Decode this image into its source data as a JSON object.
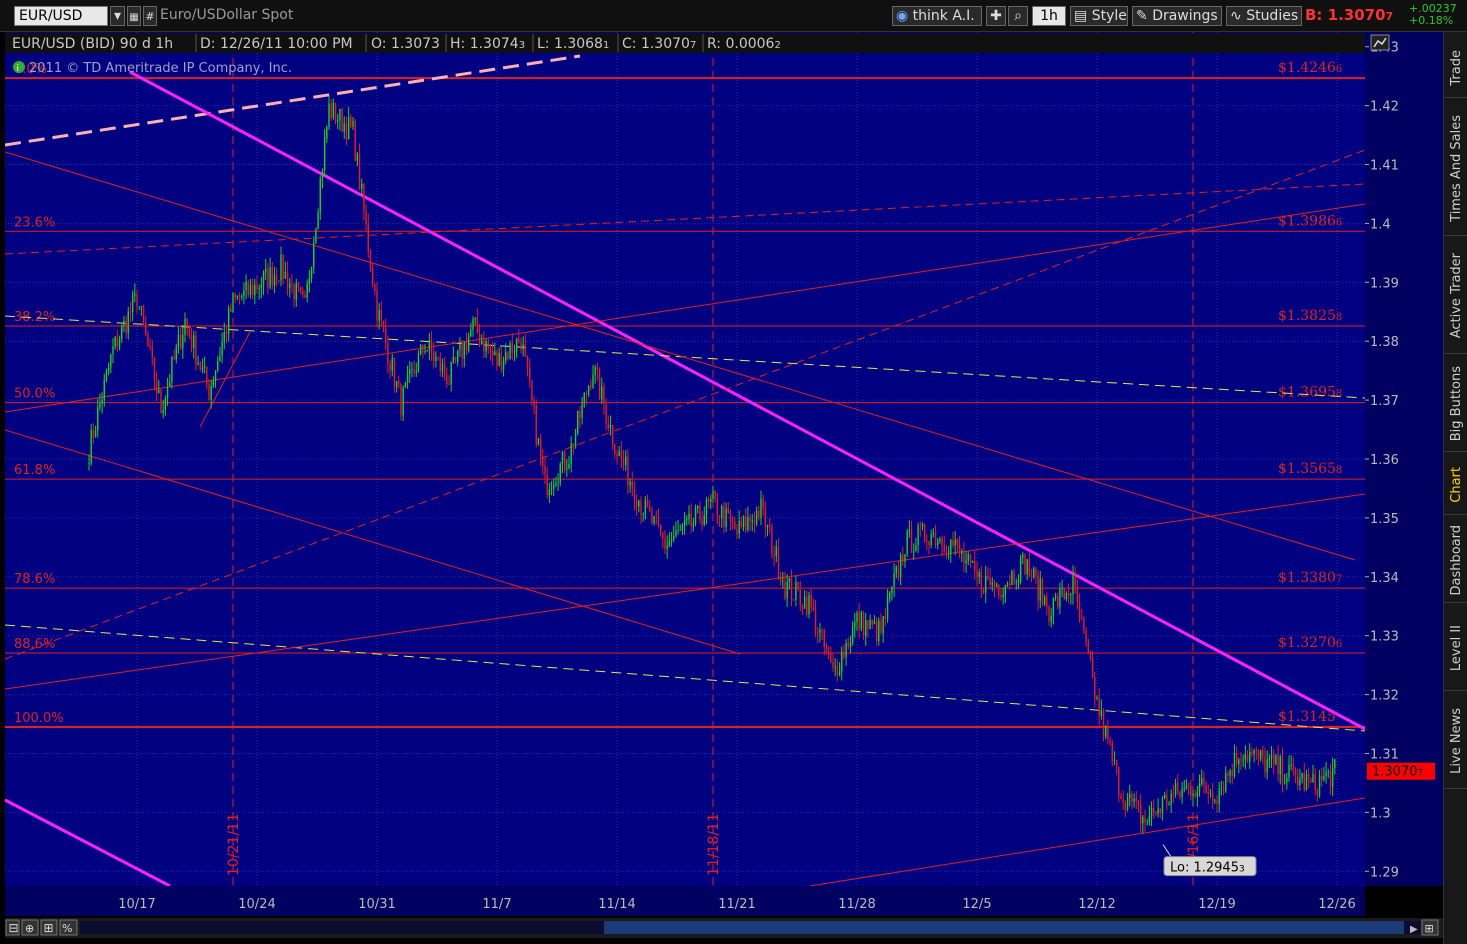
{
  "toolbar": {
    "symbol": "EUR/USD",
    "description": "Euro/USDollar Spot",
    "think_label": "think A.I.",
    "period": "1h",
    "style": "Style",
    "drawings": "Drawings",
    "studies": "Studies",
    "bid": "B: 1.3070",
    "bid_suffix": "7",
    "change_abs": "+.00237",
    "change_pct": "+0.18%"
  },
  "header": {
    "title": "EUR/USD (BID) 90 d 1h",
    "date": "D: 12/26/11 10:00 PM",
    "open": "O: 1.3073",
    "high": "H: 1.3074",
    "high_sub": "3",
    "low": "L: 1.3068",
    "low_sub": "1",
    "close": "C: 1.3070",
    "close_sub": "7",
    "range": "R: 0.0006",
    "range_sub": "2",
    "copyright": "2011 © TD Ameritrade IP Company, Inc."
  },
  "colors": {
    "background": "#000080",
    "grid": "#2a2ab0",
    "fib_line": "#e02020",
    "trend_magenta": "#ff20ff",
    "dashed_yellow": "#e6e64a",
    "dashed_pink": "#ffb0b0",
    "up_candle": "#22d022",
    "down_candle": "#e02020",
    "price_tag": "#ff0000"
  },
  "side_tabs": [
    "Trade",
    "Times And Sales",
    "Active Trader",
    "Big Buttons",
    "Chart",
    "Dashboard",
    "Level II",
    "Live News"
  ],
  "side_active": "Chart",
  "chart_data": {
    "type": "candlestick",
    "symbol": "EUR/USD",
    "x_ticks": [
      "10/17",
      "10/24",
      "10/31",
      "11/7",
      "11/14",
      "11/21",
      "11/28",
      "12/5",
      "12/12",
      "12/19",
      "12/26"
    ],
    "y_ticks": [
      1.29,
      1.3,
      1.31,
      1.32,
      1.33,
      1.34,
      1.35,
      1.36,
      1.37,
      1.38,
      1.39,
      1.4,
      1.41,
      1.42,
      1.43
    ],
    "ylim": [
      1.2875,
      1.4325
    ],
    "fib_levels": [
      {
        "pct": "0.0%",
        "price": "$1.4246",
        "sub": "6",
        "value": 1.42466
      },
      {
        "pct": "23.6%",
        "price": "$1.3986",
        "sub": "6",
        "value": 1.39866
      },
      {
        "pct": "38.2%",
        "price": "$1.3825",
        "sub": "8",
        "value": 1.38258
      },
      {
        "pct": "50.0%",
        "price": "$1.3695",
        "sub": "8",
        "value": 1.36958
      },
      {
        "pct": "61.8%",
        "price": "$1.3565",
        "sub": "8",
        "value": 1.35658
      },
      {
        "pct": "78.6%",
        "price": "$1.3380",
        "sub": "7",
        "value": 1.33807
      },
      {
        "pct": "88.6%",
        "price": "$1.3270",
        "sub": "6",
        "value": 1.32706
      },
      {
        "pct": "100.0%",
        "price": "$1.3145",
        "sub": "",
        "value": 1.3145
      }
    ],
    "vertical_markers": [
      {
        "label": "10/21/11",
        "date": "2011-10-21"
      },
      {
        "label": "11/18/11",
        "date": "2011-11-18"
      },
      {
        "label": "12/16/11",
        "date": "2011-12-16"
      }
    ],
    "last_price": "1.3070",
    "last_price_sub": "7",
    "last_value": 1.30707,
    "low_label": "Lo: 1.2945",
    "low_label_sub": "3",
    "low_value": 1.29453,
    "close_path": [
      [
        "2011-10-13",
        1.3615
      ],
      [
        "2011-10-14",
        1.3785
      ],
      [
        "2011-10-17",
        1.3875
      ],
      [
        "2011-10-18",
        1.3685
      ],
      [
        "2011-10-19",
        1.3835
      ],
      [
        "2011-10-20",
        1.3715
      ],
      [
        "2011-10-21",
        1.3865
      ],
      [
        "2011-10-24",
        1.3895
      ],
      [
        "2011-10-25",
        1.3925
      ],
      [
        "2011-10-26",
        1.3855
      ],
      [
        "2011-10-27",
        1.4195
      ],
      [
        "2011-10-28",
        1.4155
      ],
      [
        "2011-10-31",
        1.3855
      ],
      [
        "2011-11-01",
        1.3695
      ],
      [
        "2011-11-02",
        1.3795
      ],
      [
        "2011-11-03",
        1.3735
      ],
      [
        "2011-11-04",
        1.3825
      ],
      [
        "2011-11-07",
        1.3765
      ],
      [
        "2011-11-08",
        1.3805
      ],
      [
        "2011-11-09",
        1.3555
      ],
      [
        "2011-11-10",
        1.3605
      ],
      [
        "2011-11-11",
        1.3755
      ],
      [
        "2011-11-14",
        1.3615
      ],
      [
        "2011-11-15",
        1.3525
      ],
      [
        "2011-11-16",
        1.3455
      ],
      [
        "2011-11-17",
        1.3485
      ],
      [
        "2011-11-18",
        1.3525
      ],
      [
        "2011-11-21",
        1.3475
      ],
      [
        "2011-11-22",
        1.3515
      ],
      [
        "2011-11-23",
        1.3385
      ],
      [
        "2011-11-24",
        1.3355
      ],
      [
        "2011-11-25",
        1.3235
      ],
      [
        "2011-11-28",
        1.3325
      ],
      [
        "2011-11-29",
        1.3305
      ],
      [
        "2011-11-30",
        1.3455
      ],
      [
        "2011-12-01",
        1.3475
      ],
      [
        "2011-12-02",
        1.3455
      ],
      [
        "2011-12-05",
        1.3395
      ],
      [
        "2011-12-06",
        1.3385
      ],
      [
        "2011-12-07",
        1.3425
      ],
      [
        "2011-12-08",
        1.3345
      ],
      [
        "2011-12-09",
        1.3385
      ],
      [
        "2011-12-12",
        1.3185
      ],
      [
        "2011-12-13",
        1.3035
      ],
      [
        "2011-12-14",
        1.2985
      ],
      [
        "2011-12-15",
        1.3025
      ],
      [
        "2011-12-16",
        1.3045
      ],
      [
        "2011-12-19",
        1.3035
      ],
      [
        "2011-12-20",
        1.3105
      ],
      [
        "2011-12-21",
        1.3085
      ],
      [
        "2011-12-22",
        1.3065
      ],
      [
        "2011-12-23",
        1.3045
      ],
      [
        "2011-12-26",
        1.30707
      ]
    ]
  }
}
